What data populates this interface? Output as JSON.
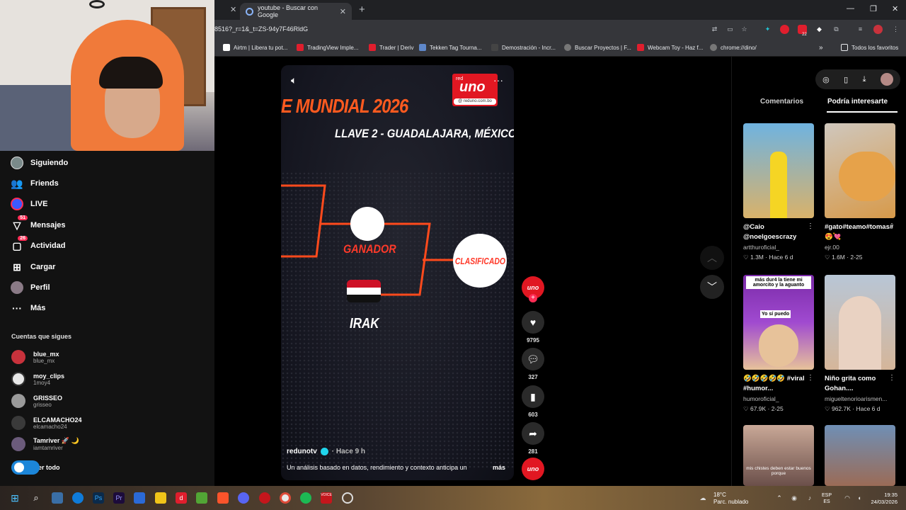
{
  "browser": {
    "tab_title": "youtube - Buscar con Google",
    "url": "8516?_r=1&_t=ZS-94y7F46RldG",
    "bookmarks": [
      {
        "label": "Airtm | Libera tu pot...",
        "color": "#ffffff"
      },
      {
        "label": "TradingView Imple...",
        "color": "#e01e2d"
      },
      {
        "label": "Trader | Deriv",
        "color": "#e01e2d"
      },
      {
        "label": "Tekken Tag Tourna...",
        "color": "#5e87c9"
      },
      {
        "label": "Demostración - Incr...",
        "color": "#444444"
      },
      {
        "label": "Buscar Proyectos | F...",
        "color": "#777777"
      },
      {
        "label": "Webcam Toy - Haz f...",
        "color": "#e01e2d"
      },
      {
        "label": "chrome://dino/",
        "color": "#777777"
      }
    ],
    "all_bookmarks": "Todos los favoritos",
    "ext_badge": "22"
  },
  "sidebar": {
    "nav": [
      {
        "label": "Siguiendo",
        "icon": "following-avatar-icon"
      },
      {
        "label": "Friends",
        "icon": "friends-icon"
      },
      {
        "label": "LIVE",
        "icon": "live-icon"
      },
      {
        "label": "Mensajes",
        "icon": "messages-icon",
        "badge": "51"
      },
      {
        "label": "Actividad",
        "icon": "activity-icon",
        "badge": "26"
      },
      {
        "label": "Cargar",
        "icon": "upload-icon"
      },
      {
        "label": "Perfil",
        "icon": "profile-avatar-icon"
      },
      {
        "label": "Más",
        "icon": "more-icon"
      }
    ],
    "following_title": "Cuentas que sigues",
    "following": [
      {
        "name": "blue_mx",
        "handle": "blue_mx",
        "color": "#c8323c"
      },
      {
        "name": "moy_clips",
        "handle": "1moy4",
        "color": "#e8e8e8"
      },
      {
        "name": "GRISSEO",
        "handle": "grisseo",
        "color": "#9a9a9a"
      },
      {
        "name": "ELCAMACHO24",
        "handle": "elcamacho24",
        "color": "#3a3a3a"
      },
      {
        "name": "Tamriver 🚀 🌙",
        "handle": "iamtamriver",
        "color": "#6b5b7b"
      }
    ],
    "see_all": "er todo"
  },
  "video": {
    "title_text": "E MUNDIAL 2026",
    "subtitle_text": "LLAVE 2 - GUADALAJARA, MÉXICO",
    "logo_top": "red",
    "logo_main": "uno",
    "logo_url": "@ reduno.com.bo",
    "winner_text": "GANADOR",
    "team_text": "IRAK",
    "qualified_text": "CLASIFICADO",
    "author": "redunotv",
    "time": "· Hace 9 h",
    "description": "Un análisis basado en datos, rendimiento y contexto anticipa un",
    "more": "más",
    "progress": 0.62
  },
  "actions": {
    "creator_logo": "uno",
    "likes": "9795",
    "comments": "327",
    "saves": "603",
    "shares": "281"
  },
  "right_panel": {
    "tabs": [
      "Comentarios",
      "Podría interesarte"
    ],
    "active_tab": 1,
    "cards": [
      {
        "caption": "@Caio @noelgoescrazy",
        "author": "artthuroficial_",
        "stats": "♡ 1.3M · Hace 6 d",
        "bg1": "#6fb3e0",
        "bg2": "#d9b26a"
      },
      {
        "caption": "#gato#teamo#tomas#😍💘",
        "author": "ejr.00",
        "stats": "♡ 1.6M · 2-25",
        "bg1": "#cfc7bd",
        "bg2": "#d79a4a"
      },
      {
        "caption": "🤣🤣🤣🤣🤣 #viral #humor...",
        "author": "humoroficial_",
        "stats": "♡ 67.9K · 2-25",
        "bg1": "#7a2aa8",
        "bg2": "#e7c29a"
      },
      {
        "caption": "Niño grita como Gohan....",
        "author": "migueltenorioarismen...",
        "stats": "♡ 962.7K · Hace 6 d",
        "bg1": "#b8c6d6",
        "bg2": "#d5b69a"
      },
      {
        "caption": "",
        "author": "",
        "stats": "",
        "bg1": "#c9a897",
        "bg2": "#6b4f4a"
      },
      {
        "caption": "",
        "author": "",
        "stats": "",
        "bg1": "#6f8fb5",
        "bg2": "#9b6b56"
      }
    ],
    "thumb_texts": [
      "más dur4 la tiene mi amorcito y la aguanto",
      "Yo sí puedo",
      "mis chistes deben estar buenos porque"
    ]
  },
  "taskbar": {
    "weather_temp": "18°C",
    "weather_desc": "Parc. nublado",
    "lang1": "ESP",
    "lang2": "ES",
    "time": "19:35",
    "date": "24/03/2026"
  }
}
